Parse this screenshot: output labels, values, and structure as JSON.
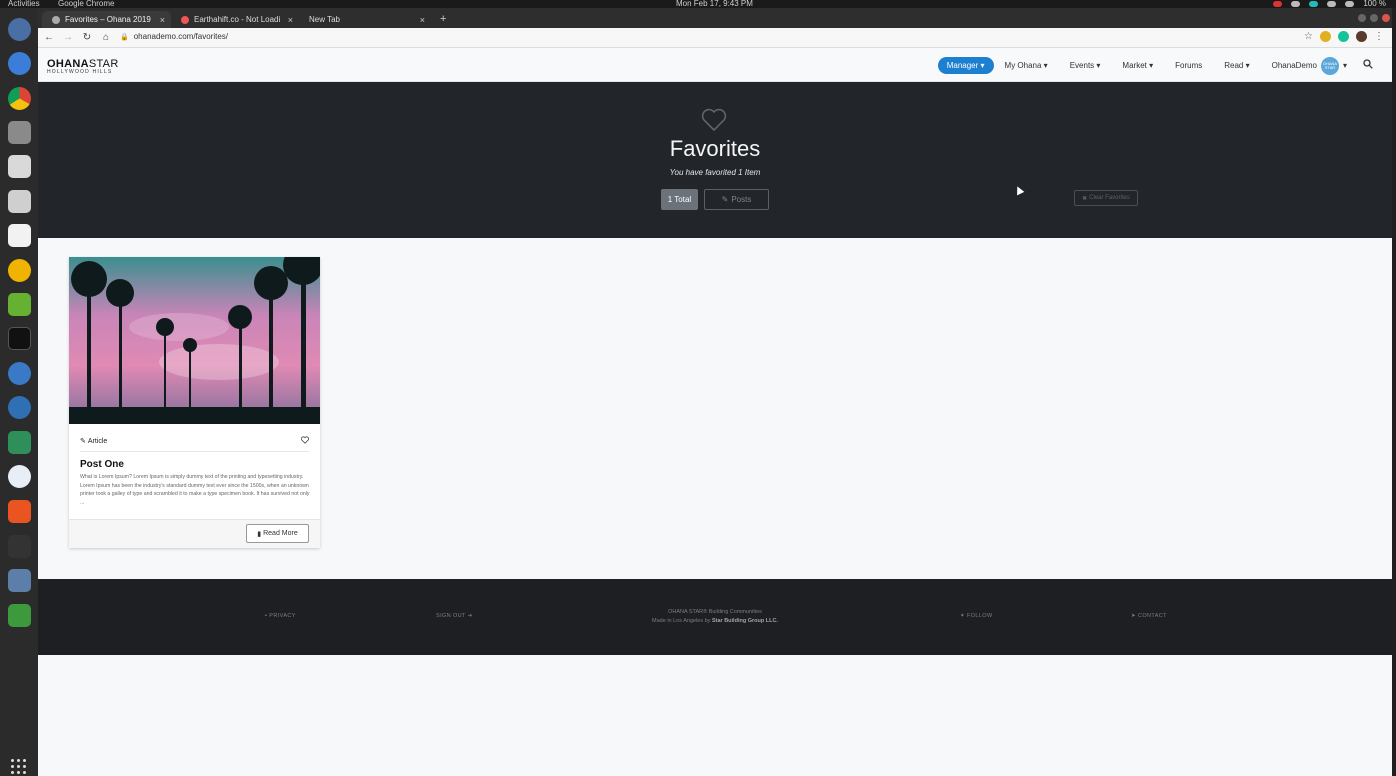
{
  "os": {
    "activities": "Activities",
    "app_name": "Google Chrome",
    "clock": "Mon Feb 17,  9:43 PM",
    "battery": "100 %"
  },
  "browser": {
    "tabs": [
      {
        "title": "Favorites – Ohana 2019"
      },
      {
        "title": "Earthahift.co - Not Loadi"
      },
      {
        "title": "New Tab"
      }
    ],
    "url": "ohanademo.com/favorites/"
  },
  "site": {
    "logo_bold": "OHANA",
    "logo_light": "STAR",
    "logo_sub": "HOLLYWOOD HILLS",
    "nav": {
      "manager": "Manager",
      "my_ohana": "My Ohana",
      "events": "Events",
      "market": "Market",
      "forums": "Forums",
      "read": "Read",
      "user": "OhanaDemo",
      "avatar_text": "OHANA STAR"
    },
    "hero": {
      "title": "Favorites",
      "subtitle": "You have favorited 1 Item",
      "total_button": "1 Total",
      "posts_button": "Posts",
      "clear_button": "Clear Favorites"
    },
    "card": {
      "type": "Article",
      "title": "Post One",
      "excerpt": "What is Lorem Ipsum? Lorem Ipsum is simply dummy text of the printing and typesetting industry. Lorem Ipsum has been the industry's standard dummy text ever since the 1500s, when an unknown printer took a galley of type and scrambled it to make a type specimen book. It has survived not only ...",
      "read_more": "Read More"
    },
    "footer": {
      "privacy": "PRIVACY",
      "sign_out": "SIGN OUT",
      "line1": "OHANA STAR® Building Communities",
      "line2_prefix": "Made in Los Angeles by",
      "line2_company": "Star Building Group LLC.",
      "follow": "FOLLOW",
      "contact": "CONTACT"
    }
  },
  "colors": {
    "accent": "#1d7fd0",
    "hero_bg": "#22262b",
    "footer_bg": "#1d1f22"
  }
}
